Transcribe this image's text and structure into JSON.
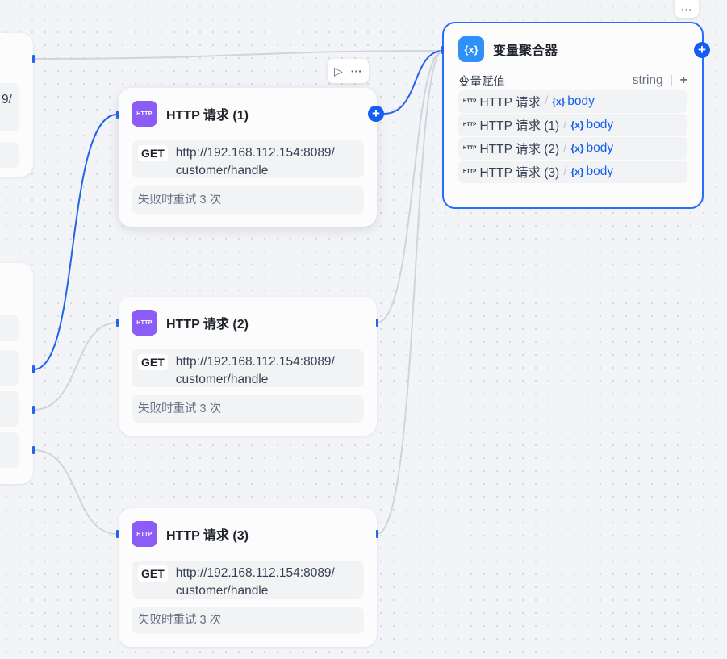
{
  "nodes": [
    {
      "title": "HTTP 请求 (1)",
      "icon_label": "HTTP",
      "method": "GET",
      "url_line1": "http://192.168.112.154:8089/",
      "url_line2": "customer/handle",
      "retry": "失败时重试 3 次"
    },
    {
      "title": "HTTP 请求 (2)",
      "icon_label": "HTTP",
      "method": "GET",
      "url_line1": "http://192.168.112.154:8089/",
      "url_line2": "customer/handle",
      "retry": "失败时重试 3 次"
    },
    {
      "title": "HTTP 请求 (3)",
      "icon_label": "HTTP",
      "method": "GET",
      "url_line1": "http://192.168.112.154:8089/",
      "url_line2": "customer/handle",
      "retry": "失败时重试 3 次"
    }
  ],
  "aggregator": {
    "title": "变量聚合器",
    "icon_label": "{x}",
    "section_label": "变量赋值",
    "type": "string",
    "add": "+",
    "rows": [
      {
        "icon_label": "HTTP",
        "source": "HTTP 请求",
        "var_icon": "{x}",
        "var": "body"
      },
      {
        "icon_label": "HTTP",
        "source": "HTTP 请求 (1)",
        "var_icon": "{x}",
        "var": "body"
      },
      {
        "icon_label": "HTTP",
        "source": "HTTP 请求 (2)",
        "var_icon": "{x}",
        "var": "body"
      },
      {
        "icon_label": "HTTP",
        "source": "HTTP 请求 (3)",
        "var_icon": "{x}",
        "var": "body"
      }
    ]
  },
  "toolbar": {
    "run_glyph": "▷",
    "more_glyph": "···"
  },
  "left_partial": {
    "text": "9/"
  },
  "plus_glyph": "+",
  "colors": {
    "accent": "#155eef",
    "http_icon": "#8b5cf6",
    "agg_icon": "#2e90fa",
    "wire_active": "#2563eb",
    "wire_idle": "#d0d5dd"
  }
}
